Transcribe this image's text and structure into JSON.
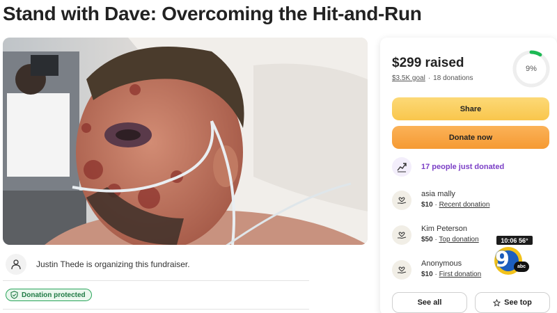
{
  "page": {
    "title": "Stand with Dave: Overcoming the Hit-and-Run"
  },
  "organizer": {
    "text": "Justin Thede is organizing this fundraiser.",
    "icon": "person-icon"
  },
  "badge": {
    "label": "Donation protected",
    "icon": "shield-check-icon",
    "color": "#2aa55a"
  },
  "card": {
    "raised": "$299 raised",
    "goal": "$3.5K goal",
    "donations": "18 donations",
    "progress_label": "9%",
    "progress_fraction": 0.09,
    "progress_color": "#1db954",
    "share_label": "Share",
    "donate_label": "Donate now",
    "trending_text": "17 people just donated",
    "trending_icon": "trend-up-icon",
    "donors": [
      {
        "name": "asia mally",
        "amount": "$10",
        "tag": "Recent donation"
      },
      {
        "name": "Kim Peterson",
        "amount": "$50",
        "tag": "Top donation"
      },
      {
        "name": "Anonymous",
        "amount": "$10",
        "tag": "First donation"
      }
    ],
    "see_all_label": "See all",
    "see_top_label": "See top"
  },
  "overlay": {
    "time": "10:06  56°",
    "channel": "9",
    "network": "abc"
  },
  "colors": {
    "share_button": "#f9c64c",
    "donate_button": "#f59a33",
    "trending_text": "#7b3fc6"
  }
}
